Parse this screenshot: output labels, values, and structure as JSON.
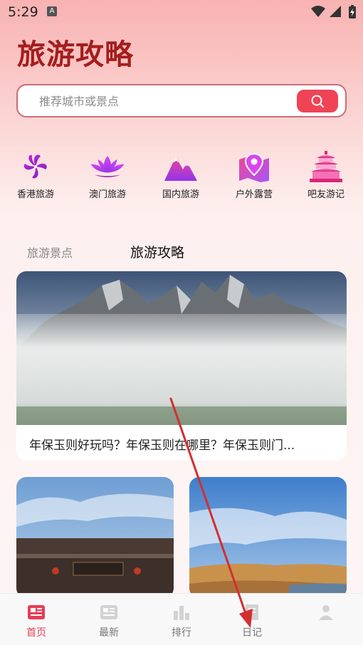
{
  "status_bar": {
    "time": "5:29",
    "notification_icon": "A"
  },
  "header": {
    "title": "旅游攻略"
  },
  "search": {
    "placeholder": "推荐城市或景点"
  },
  "categories": [
    {
      "label": "香港旅游",
      "icon": "bauhinia-icon"
    },
    {
      "label": "澳门旅游",
      "icon": "lotus-icon"
    },
    {
      "label": "国内旅游",
      "icon": "mountain-icon"
    },
    {
      "label": "户外露营",
      "icon": "map-pin-icon"
    },
    {
      "label": "吧友游记",
      "icon": "temple-icon"
    }
  ],
  "tabs": [
    {
      "label": "旅游景点",
      "active": false
    },
    {
      "label": "旅游攻略",
      "active": true
    }
  ],
  "feature": {
    "caption": "年保玉则好玩吗？年保玉则在哪里？年保玉则门..."
  },
  "bottom_nav": [
    {
      "label": "首页",
      "active": true
    },
    {
      "label": "最新",
      "active": false
    },
    {
      "label": "排行",
      "active": false
    },
    {
      "label": "日记",
      "active": false
    },
    {
      "label": "",
      "active": false
    }
  ],
  "colors": {
    "accent": "#e93d57",
    "title": "#a51d1d",
    "search_button": "#ef4456"
  }
}
